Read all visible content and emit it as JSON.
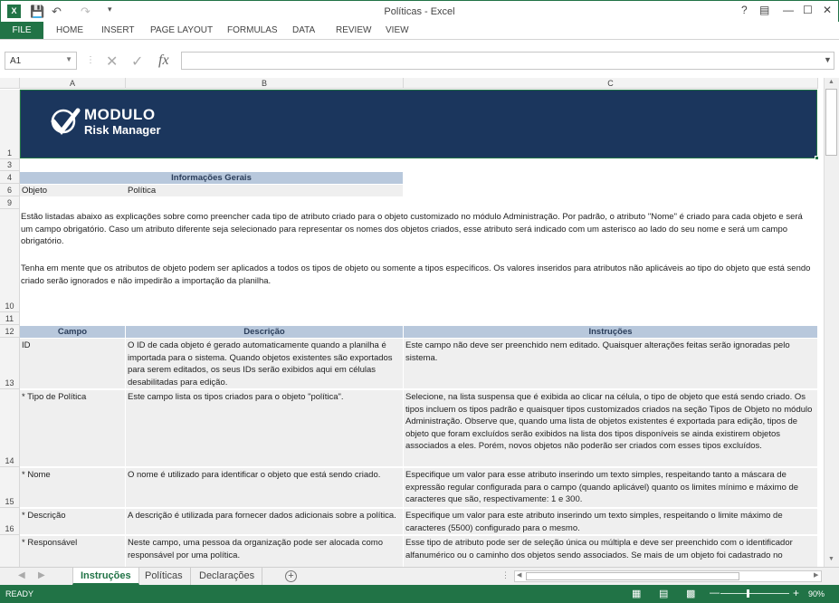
{
  "window": {
    "title": "Políticas - Excel"
  },
  "ribbon": {
    "file": "FILE",
    "tabs": [
      "HOME",
      "INSERT",
      "PAGE LAYOUT",
      "FORMULAS",
      "DATA",
      "REVIEW",
      "VIEW"
    ]
  },
  "formula_bar": {
    "name_box": "A1",
    "formula": ""
  },
  "columns": [
    "A",
    "B",
    "C"
  ],
  "rows": {
    "r1": "1",
    "r3": "3",
    "r4": "4",
    "r6": "6",
    "r9": "9",
    "r10": "10",
    "r11": "11",
    "r12": "12",
    "r13": "13",
    "r14": "14",
    "r15": "15",
    "r16": "16"
  },
  "banner": {
    "logo_text_1": "MODULO",
    "logo_text_2": "Risk Manager"
  },
  "info": {
    "header": "Informações Gerais",
    "label": "Objeto",
    "value": "Política"
  },
  "intro": {
    "p1": "Estão listadas abaixo as explicações sobre como preencher cada tipo de atributo criado para o objeto customizado no módulo Administração. Por padrão, o atributo \"Nome\" é criado para cada objeto e será um campo obrigatório. Caso um atributo diferente seja selecionado para representar os nomes dos objetos criados, esse atributo será indicado com um asterisco ao lado do seu nome e será um campo obrigatório.",
    "p2": "Tenha em mente que os atributos de objeto podem ser aplicados a todos os tipos de objeto ou somente a tipos específicos. Os valores inseridos para atributos não aplicáveis ao tipo do objeto que está sendo criado serão ignorados e não impedirão a importação da planilha."
  },
  "table": {
    "headers": [
      "Campo",
      "Descrição",
      "Instruções"
    ],
    "rows": [
      {
        "campo": "ID",
        "descricao": "O ID de cada objeto é gerado automaticamente quando a planilha é importada para o sistema. Quando objetos existentes são exportados para serem editados, os seus IDs serão exibidos aqui em células desabilitadas para edição.",
        "instrucoes": "Este campo não deve ser preenchido nem editado. Quaisquer alterações feitas serão ignoradas pelo sistema."
      },
      {
        "campo": "* Tipo de Política",
        "descricao": "Este campo lista os tipos criados para o objeto \"política\".",
        "instrucoes": "Selecione, na lista suspensa que é exibida ao clicar na célula, o tipo de objeto que está sendo criado. Os tipos incluem os tipos padrão e quaisquer tipos customizados criados na seção Tipos de Objeto no módulo Administração. Observe que, quando uma lista de objetos existentes é exportada para edição, tipos de objeto que foram excluídos serão exibidos na lista dos tipos disponíveis se ainda existirem objetos associados a eles. Porém, novos objetos não poderão ser criados com esses tipos excluídos."
      },
      {
        "campo": "* Nome",
        "descricao": "O nome é utilizado para identificar o objeto que está sendo criado.",
        "instrucoes": "Especifique um valor para esse atributo inserindo um texto simples, respeitando tanto a máscara de expressão regular configurada para o campo (quando aplicável) quanto os limites mínimo e máximo de caracteres que são, respectivamente: 1 e 300."
      },
      {
        "campo": "* Descrição",
        "descricao": "A descrição é utilizada para fornecer dados adicionais sobre a política.",
        "instrucoes": "Especifique um valor para este atributo inserindo um texto simples, respeitando o limite máximo de caracteres (5500) configurado para o mesmo."
      },
      {
        "campo": "* Responsável",
        "descricao": "Neste campo, uma pessoa da organização pode ser alocada como responsável por uma política.",
        "instrucoes": "Esse tipo de atributo pode ser de seleção única ou múltipla e deve ser preenchido com o identificador alfanumérico ou o caminho dos objetos sendo associados. Se mais de um objeto foi cadastrado no"
      }
    ]
  },
  "sheets": [
    "Instruções",
    "Políticas",
    "Declarações"
  ],
  "status": {
    "ready": "READY",
    "zoom": "90%"
  }
}
